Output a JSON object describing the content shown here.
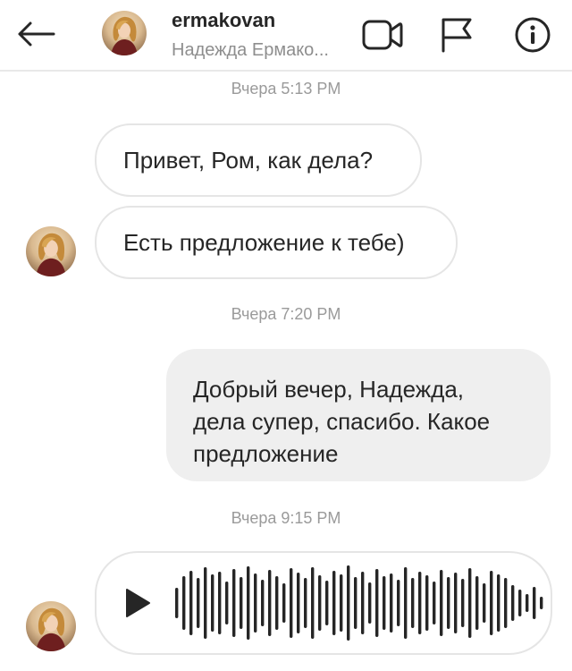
{
  "header": {
    "username": "ermakovan",
    "full_name": "Надежда Ермако...",
    "icons": {
      "back": "arrow-left-icon",
      "video": "video-camera-icon",
      "report": "flag-icon",
      "info": "info-icon"
    }
  },
  "messages": [
    {
      "type": "timestamp",
      "text": "Вчера 5:13 PM"
    },
    {
      "type": "incoming",
      "text": "Привет, Ром, как дела?"
    },
    {
      "type": "incoming",
      "text": "Есть предложение к тебе)"
    },
    {
      "type": "timestamp",
      "text": "Вчера 7:20 PM"
    },
    {
      "type": "outgoing",
      "lines": [
        "Добрый вечер, Надежда,",
        "дела супер, спасибо. Какое",
        "предложение"
      ]
    },
    {
      "type": "timestamp",
      "text": "Вчера 9:15 PM"
    },
    {
      "type": "incoming-voice",
      "icon": "play-icon"
    }
  ],
  "colors": {
    "incoming_border": "#e5e5e5",
    "outgoing_bg": "#efefef",
    "timestamp": "#9a9a9a",
    "text": "#262626",
    "secondary": "#8e8e8e"
  }
}
